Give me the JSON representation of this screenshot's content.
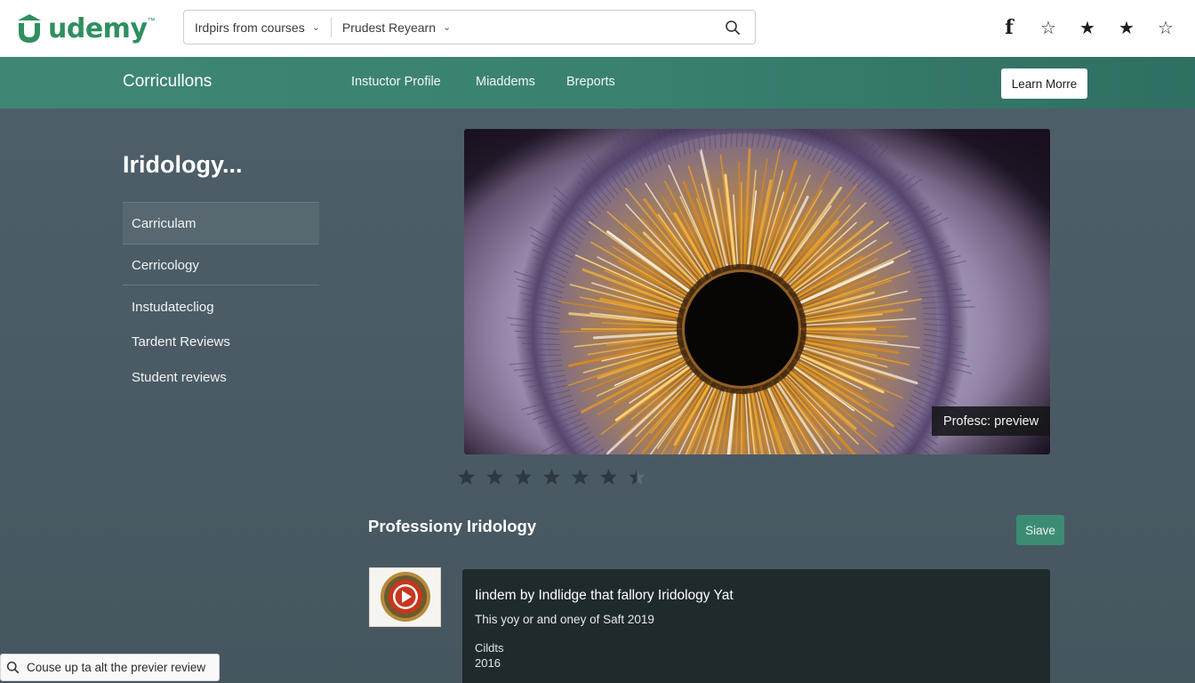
{
  "brand": {
    "name": "udemy",
    "tm": "™",
    "color": "#2f8f5f"
  },
  "search": {
    "category_label": "Irdpirs from courses",
    "filter_label": "Prudest Reyearn",
    "placeholder": "",
    "icon": "search-icon"
  },
  "top_icons": [
    {
      "name": "facebook-icon",
      "glyph": "f"
    },
    {
      "name": "star-outline-icon",
      "glyph": "☆"
    },
    {
      "name": "star-filled-icon",
      "glyph": "★"
    },
    {
      "name": "star-filled-icon",
      "glyph": "★"
    },
    {
      "name": "star-outline-icon",
      "glyph": "☆"
    }
  ],
  "nav": {
    "brand": "Corricullons",
    "links": [
      "Instuctor Profile",
      "Miaddems",
      "Breports"
    ],
    "cta": "Learn Morre"
  },
  "page": {
    "title": "Iridology..."
  },
  "sidebar": {
    "items": [
      {
        "label": "Carriculam"
      },
      {
        "label": "Cerricology"
      },
      {
        "label": "Instudatecliog"
      },
      {
        "label": "Tardent Reviews"
      },
      {
        "label": "Student reviews"
      }
    ]
  },
  "hero": {
    "preview_label": "Profesc: preview"
  },
  "rating": {
    "value": 6.5,
    "max": 7,
    "color": "#2e3840"
  },
  "course": {
    "title": "Professiony Iridology",
    "save_label": "Siave"
  },
  "info_card": {
    "title": "Iindem by Indlidge that fallory Iridology Yat",
    "subtitle": "This yoy or and oney of Saft 2019",
    "label": "Cildts",
    "year": "2016"
  },
  "bottom_search": {
    "text": "Couse up ta alt the previer review"
  },
  "colors": {
    "nav_green": "#3f8774",
    "page_bg": "#4c5d68",
    "card_bg": "#1f2a2d"
  }
}
